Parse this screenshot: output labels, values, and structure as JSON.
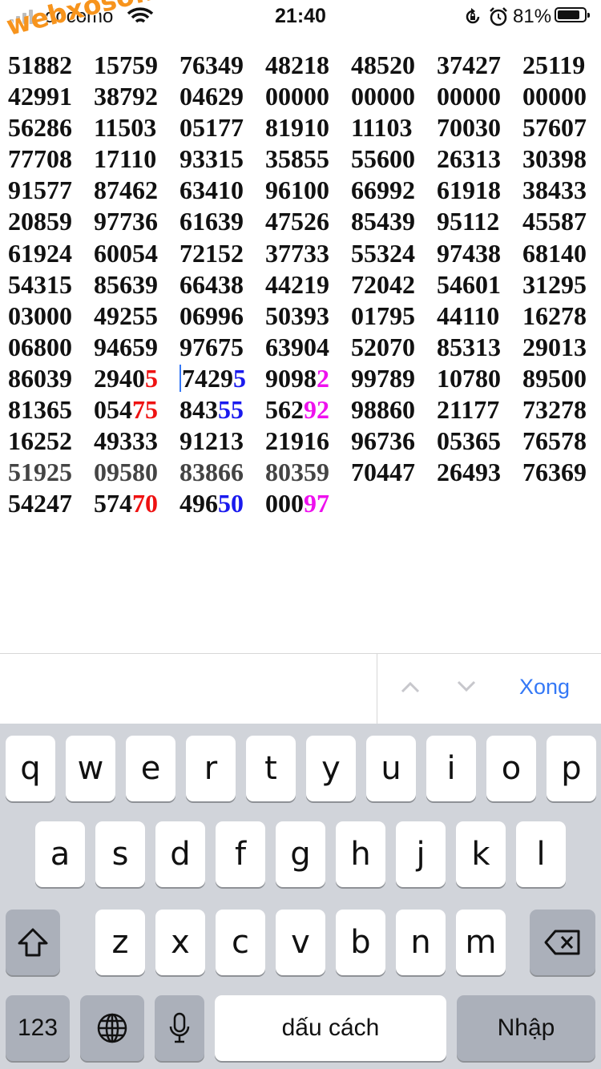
{
  "status_bar": {
    "carrier": "docomo",
    "time": "21:40",
    "battery_percent": "81%",
    "battery_level": 0.81,
    "icons": [
      "signal-icon",
      "wifi-icon",
      "rotation-lock-icon",
      "alarm-icon",
      "battery-icon"
    ]
  },
  "watermark": "webxoso.net",
  "grid": {
    "rows": [
      [
        {
          "t": "51882"
        },
        {
          "t": "15759"
        },
        {
          "t": "76349"
        },
        {
          "t": "48218"
        },
        {
          "t": "48520"
        },
        {
          "t": "37427"
        },
        {
          "t": "25119"
        }
      ],
      [
        {
          "t": "42991"
        },
        {
          "t": "38792"
        },
        {
          "t": "04629"
        },
        {
          "t": "00000"
        },
        {
          "t": "00000"
        },
        {
          "t": "00000"
        },
        {
          "t": "00000"
        }
      ],
      [
        {
          "t": "56286"
        },
        {
          "t": "11503"
        },
        {
          "t": "05177"
        },
        {
          "t": "81910"
        },
        {
          "t": "11103"
        },
        {
          "t": "70030"
        },
        {
          "t": "57607"
        }
      ],
      [
        {
          "t": "77708"
        },
        {
          "t": "17110"
        },
        {
          "t": "93315"
        },
        {
          "t": "35855"
        },
        {
          "t": "55600"
        },
        {
          "t": "26313"
        },
        {
          "t": "30398"
        }
      ],
      [
        {
          "t": "91577"
        },
        {
          "t": "87462"
        },
        {
          "t": "63410"
        },
        {
          "t": "96100"
        },
        {
          "t": "66992"
        },
        {
          "t": "61918"
        },
        {
          "t": "38433"
        }
      ],
      [
        {
          "t": "20859"
        },
        {
          "t": "97736"
        },
        {
          "t": "61639"
        },
        {
          "t": "47526"
        },
        {
          "t": "85439"
        },
        {
          "t": "95112"
        },
        {
          "t": "45587"
        }
      ],
      [
        {
          "t": "61924"
        },
        {
          "t": "60054"
        },
        {
          "t": "72152"
        },
        {
          "t": "37733"
        },
        {
          "t": "55324"
        },
        {
          "t": "97438"
        },
        {
          "t": "68140"
        }
      ],
      [
        {
          "t": "54315"
        },
        {
          "t": "85639"
        },
        {
          "t": "66438"
        },
        {
          "t": "44219"
        },
        {
          "t": "72042"
        },
        {
          "t": "54601"
        },
        {
          "t": "31295"
        }
      ],
      [
        {
          "t": "03000"
        },
        {
          "t": "49255"
        },
        {
          "t": "06996"
        },
        {
          "t": "50393"
        },
        {
          "t": "01795"
        },
        {
          "t": "44110"
        },
        {
          "t": "16278"
        }
      ],
      [
        {
          "t": "06800"
        },
        {
          "t": "94659"
        },
        {
          "t": "97675"
        },
        {
          "t": "63904"
        },
        {
          "t": "52070"
        },
        {
          "t": "85313"
        },
        {
          "t": "29013"
        }
      ],
      [
        {
          "t": "86039"
        },
        {
          "t": "2940",
          "h": "5",
          "c": "red"
        },
        {
          "t": "7429",
          "h": "5",
          "c": "blue",
          "caret": true
        },
        {
          "t": "9098",
          "h": "2",
          "c": "magenta"
        },
        {
          "t": "99789"
        },
        {
          "t": "10780"
        },
        {
          "t": "89500"
        }
      ],
      [
        {
          "t": "81365"
        },
        {
          "t": "054",
          "h": "75",
          "c": "red"
        },
        {
          "t": "843",
          "h": "55",
          "c": "blue"
        },
        {
          "t": "562",
          "h": "92",
          "c": "magenta"
        },
        {
          "t": "98860"
        },
        {
          "t": "21177"
        },
        {
          "t": "73278"
        }
      ],
      [
        {
          "t": "16252"
        },
        {
          "t": "49333"
        },
        {
          "t": "91213"
        },
        {
          "t": "21916"
        },
        {
          "t": "96736"
        },
        {
          "t": "05365"
        },
        {
          "t": "76578"
        }
      ],
      [
        {
          "t": "51925",
          "g": true
        },
        {
          "t": "09580",
          "g": true
        },
        {
          "t": "83866",
          "g": true
        },
        {
          "t": "80359",
          "g": true
        },
        {
          "t": "70447"
        },
        {
          "t": "26493"
        },
        {
          "t": "76369"
        }
      ],
      [
        {
          "t": "54247"
        },
        {
          "t": "574",
          "h": "70",
          "c": "red"
        },
        {
          "t": "496",
          "h": "50",
          "c": "blue"
        },
        {
          "t": "000",
          "h": "97",
          "c": "magenta"
        }
      ]
    ]
  },
  "find_bar": {
    "search_value": "",
    "done_label": "Xong",
    "prev_icon": "chevron-up-icon",
    "next_icon": "chevron-down-icon"
  },
  "keyboard": {
    "row1": [
      "q",
      "w",
      "e",
      "r",
      "t",
      "y",
      "u",
      "i",
      "o",
      "p"
    ],
    "row2": [
      "a",
      "s",
      "d",
      "f",
      "g",
      "h",
      "j",
      "k",
      "l"
    ],
    "row3": [
      "z",
      "x",
      "c",
      "v",
      "b",
      "n",
      "m"
    ],
    "numbers_label": "123",
    "space_label": "dấu cách",
    "return_label": "Nhập",
    "shift_icon": "shift-icon",
    "backspace_icon": "backspace-icon",
    "globe_icon": "globe-icon",
    "mic_icon": "microphone-icon"
  }
}
